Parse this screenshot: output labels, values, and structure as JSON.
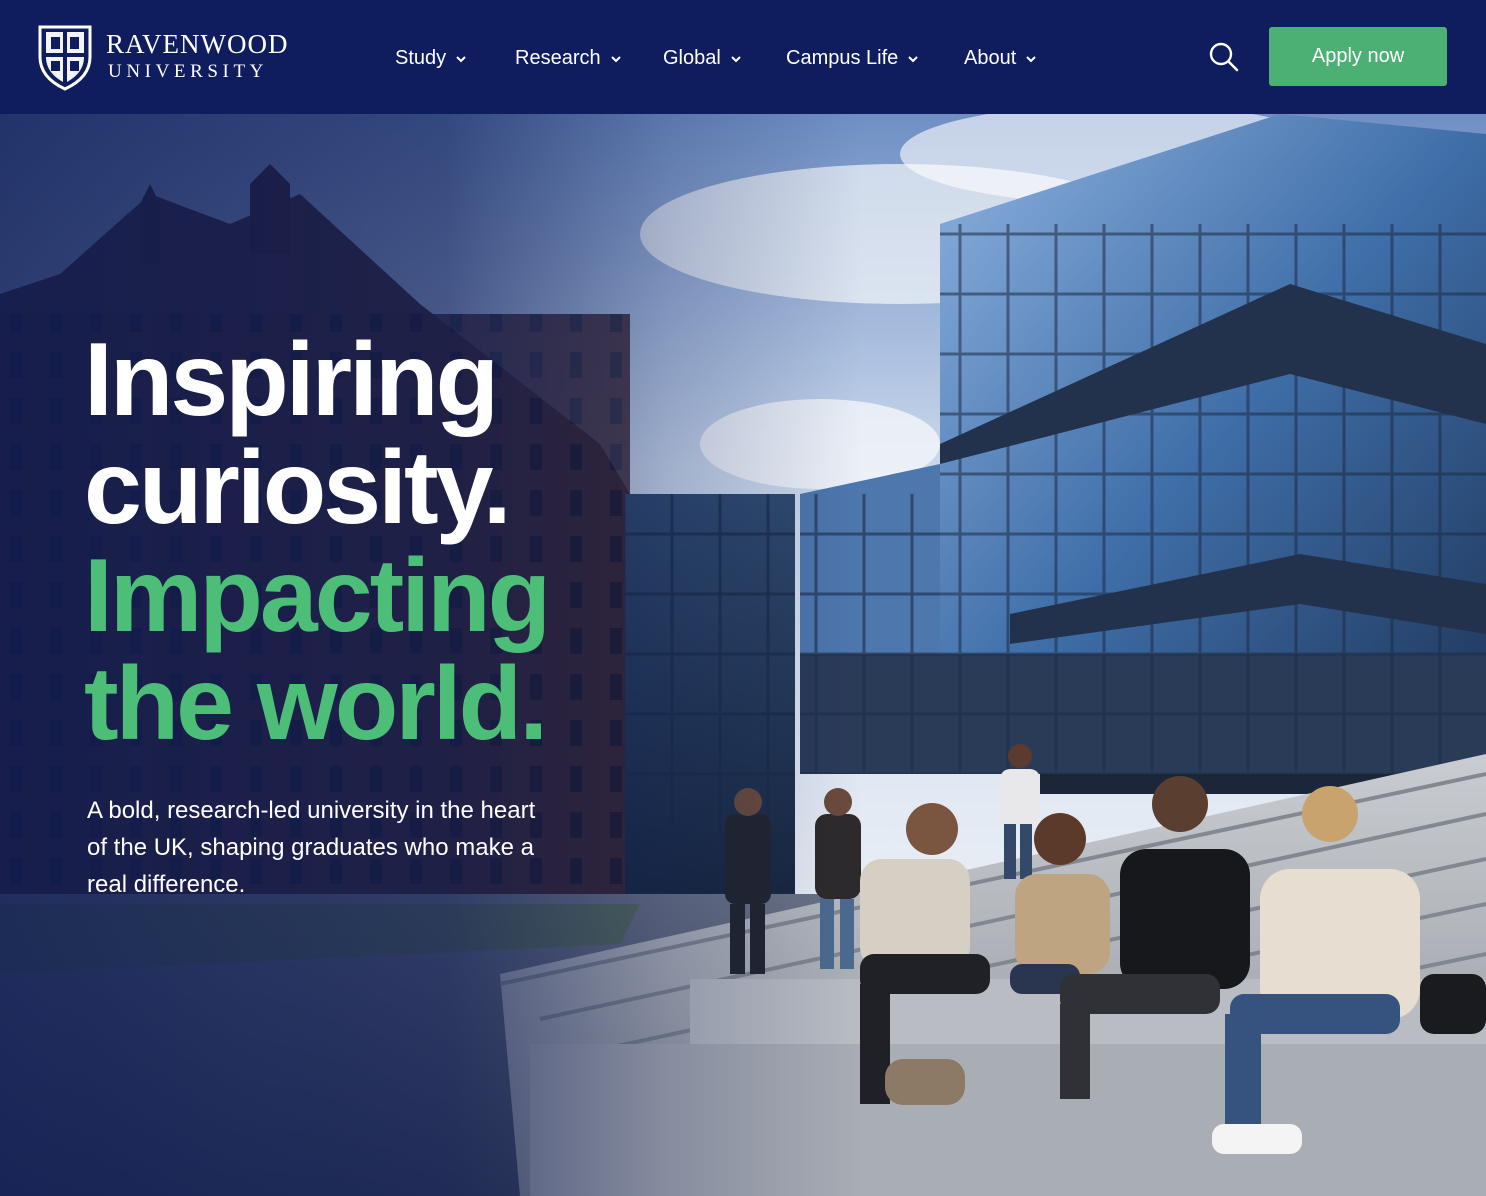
{
  "header": {
    "logo": {
      "name": "RAVENWOOD",
      "subtitle": "UNIVERSITY"
    },
    "nav": [
      {
        "label": "Study"
      },
      {
        "label": "Research"
      },
      {
        "label": "Global"
      },
      {
        "label": "Campus Life"
      },
      {
        "label": "About"
      }
    ],
    "search_icon": "search-icon",
    "apply_label": "Apply now"
  },
  "hero": {
    "headline": {
      "line1": "Inspiring",
      "line2": "curiosity.",
      "line3": "Impacting",
      "line4": "the world."
    },
    "subtext": "A bold, research-led university in the heart of the UK, shaping graduates who make a real difference."
  },
  "colors": {
    "header_bg": "#0f1d5e",
    "accent_green": "#4caf74",
    "headline_green": "#4cbe78",
    "text_white": "#ffffff"
  }
}
